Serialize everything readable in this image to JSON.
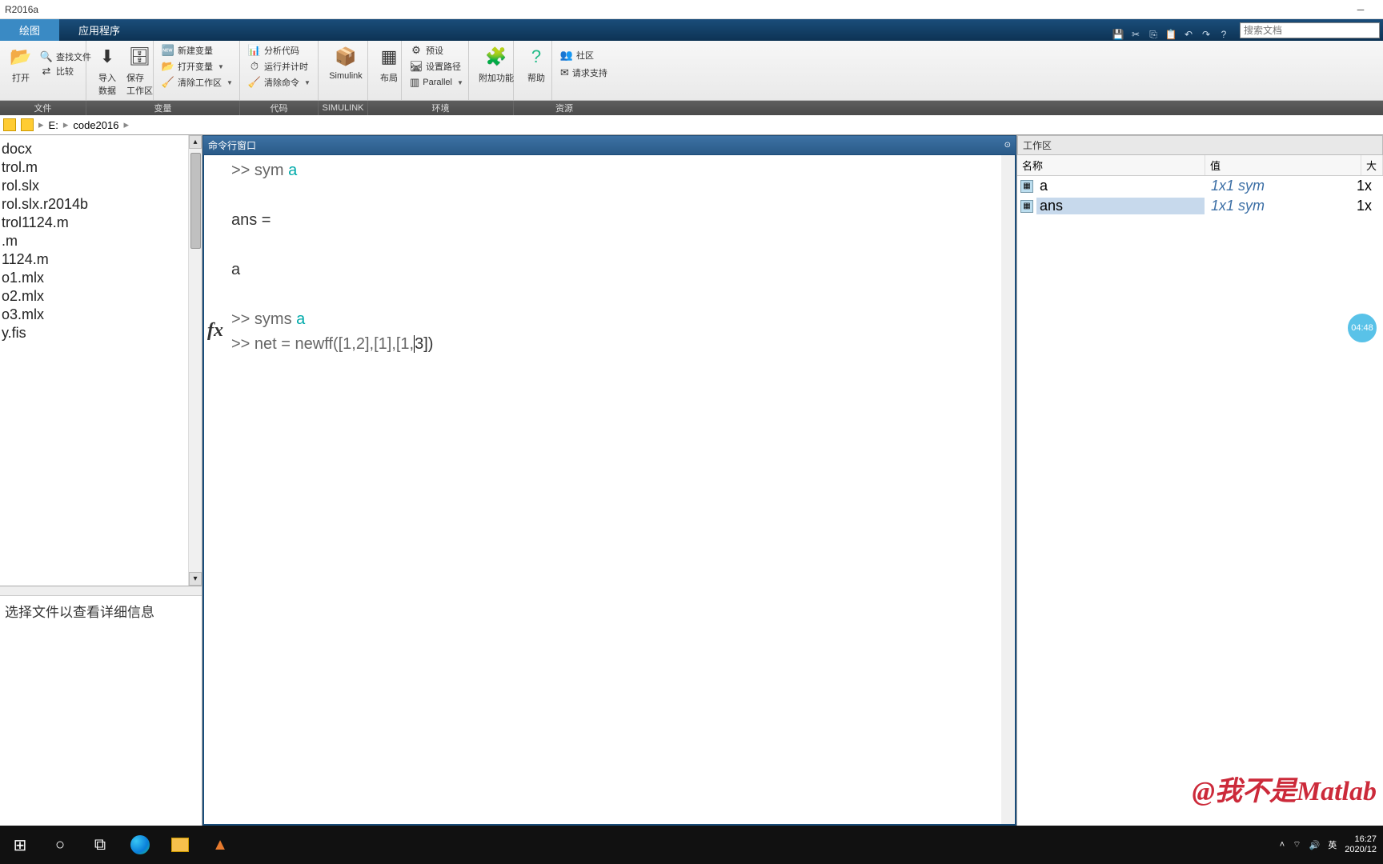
{
  "title": "R2016a",
  "tabs": {
    "plot": "绘图",
    "apps": "应用程序"
  },
  "search_placeholder": "搜索文档",
  "ribbon": {
    "open": "打开",
    "find_files": "查找文件",
    "compare": "比较",
    "import": "导入\n数据",
    "save_ws": "保存\n工作区",
    "new_var": "新建变量",
    "open_var": "打开变量",
    "clear_ws": "清除工作区",
    "analyze": "分析代码",
    "run_time": "运行并计时",
    "clear_cmd": "清除命令",
    "simulink": "Simulink",
    "layout": "布局",
    "prefs": "预设",
    "set_path": "设置路径",
    "parallel": "Parallel",
    "addons": "附加功能",
    "help": "帮助",
    "community": "社区",
    "support": "请求支持"
  },
  "group_labels": {
    "file": "文件",
    "var": "变量",
    "code": "代码",
    "simulink": "SIMULINK",
    "env": "环境",
    "res": "资源"
  },
  "address": {
    "drive": "E:",
    "folder": "code2016"
  },
  "files": [
    "docx",
    "trol.m",
    "rol.slx",
    "rol.slx.r2014b",
    "trol1124.m",
    ".m",
    "1124.m",
    "o1.mlx",
    "o2.mlx",
    "o3.mlx",
    "y.fis"
  ],
  "detail_msg": "选择文件以查看详细信息",
  "cmd": {
    "title": "命令行窗口",
    "line1_pre": ">> sym ",
    "line1_var": "a",
    "line2": "ans =",
    "line3": "a",
    "line4_pre": ">> syms ",
    "line4_var": "a",
    "line5_pre": ">> net = newff([1,2],[1],[1,",
    "line5_post": "3])"
  },
  "workspace": {
    "title": "工作区",
    "cols": {
      "name": "名称",
      "value": "值",
      "size": "大"
    },
    "rows": [
      {
        "name": "a",
        "value": "1x1 sym",
        "size": "1x"
      },
      {
        "name": "ans",
        "value": "1x1 sym",
        "size": "1x",
        "selected": true
      }
    ]
  },
  "watermark": "@我不是Matlab",
  "timer": "04:48",
  "taskbar": {
    "ime": "英",
    "time": "16:27",
    "date": "2020/12"
  }
}
